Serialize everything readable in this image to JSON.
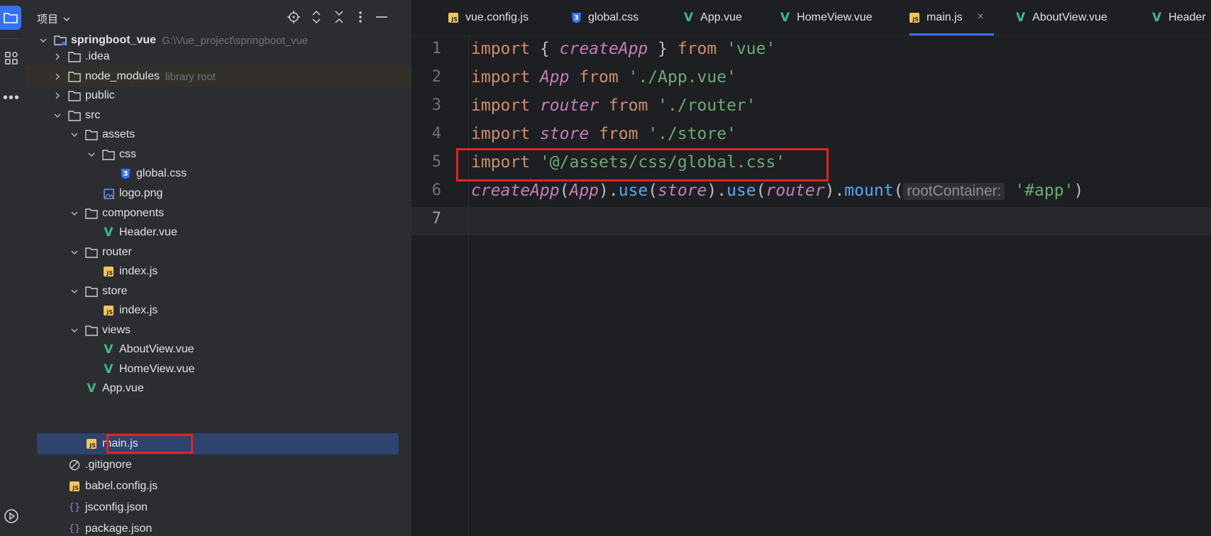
{
  "panel": {
    "title": "项目",
    "icons": [
      "locate-icon",
      "expand-icon",
      "collapse-icon",
      "more-icon",
      "minimize-icon"
    ]
  },
  "tree": {
    "root": {
      "name": "springboot_vue",
      "path": "G:\\Vue_project\\springboot_vue"
    },
    "items": [
      {
        "label": ".idea"
      },
      {
        "label": "node_modules",
        "hint": "library root"
      },
      {
        "label": "public"
      },
      {
        "label": "src"
      },
      {
        "label": "assets"
      },
      {
        "label": "css"
      },
      {
        "label": "global.css"
      },
      {
        "label": "logo.png"
      },
      {
        "label": "components"
      },
      {
        "label": "Header.vue"
      },
      {
        "label": "router"
      },
      {
        "label": "index.js"
      },
      {
        "label": "store"
      },
      {
        "label": "index.js"
      },
      {
        "label": "views"
      },
      {
        "label": "AboutView.vue"
      },
      {
        "label": "HomeView.vue"
      },
      {
        "label": "App.vue"
      },
      {
        "label": "main.js"
      },
      {
        "label": ".gitignore"
      },
      {
        "label": "babel.config.js"
      },
      {
        "label": "jsconfig.json"
      },
      {
        "label": "package.json"
      }
    ]
  },
  "tabs": [
    {
      "label": "vue.config.js"
    },
    {
      "label": "global.css"
    },
    {
      "label": "App.vue"
    },
    {
      "label": "HomeView.vue"
    },
    {
      "label": "main.js",
      "active": true
    },
    {
      "label": "AboutView.vue"
    },
    {
      "label": "Header"
    }
  ],
  "editor": {
    "line_numbers": [
      "1",
      "2",
      "3",
      "4",
      "5",
      "6",
      "7"
    ],
    "current_line": "7",
    "l1": {
      "kw": "import",
      "b1": " { ",
      "id": "createApp",
      "b2": " } ",
      "from": "from",
      "sp": " ",
      "str": "'vue'"
    },
    "l2": {
      "kw": "import",
      "sp1": " ",
      "id": "App",
      "sp2": " ",
      "from": "from",
      "sp3": " ",
      "str": "'./App.vue'"
    },
    "l3": {
      "kw": "import",
      "sp1": " ",
      "id": "router",
      "sp2": " ",
      "from": "from",
      "sp3": " ",
      "str": "'./router'"
    },
    "l4": {
      "kw": "import",
      "sp1": " ",
      "id": "store",
      "sp2": " ",
      "from": "from",
      "sp3": " ",
      "str": "'./store'"
    },
    "l5": {
      "kw": "import",
      "sp1": " ",
      "str": "'@/assets/css/global.css'"
    },
    "l6": {
      "fn1": "createApp",
      "p1": "(",
      "a1": "App",
      "p2": ").",
      "use1": "use",
      "p3": "(",
      "a2": "store",
      "p4": ").",
      "use2": "use",
      "p5": "(",
      "a3": "router",
      "p6": ").",
      "mount": "mount",
      "p7": "(",
      "hint": "rootContainer:",
      "sp": " ",
      "str": "'#app'",
      "p8": ")"
    }
  },
  "colors": {
    "accent": "#3574f0",
    "highlight_box": "#e32323",
    "selection": "#2e436e"
  }
}
